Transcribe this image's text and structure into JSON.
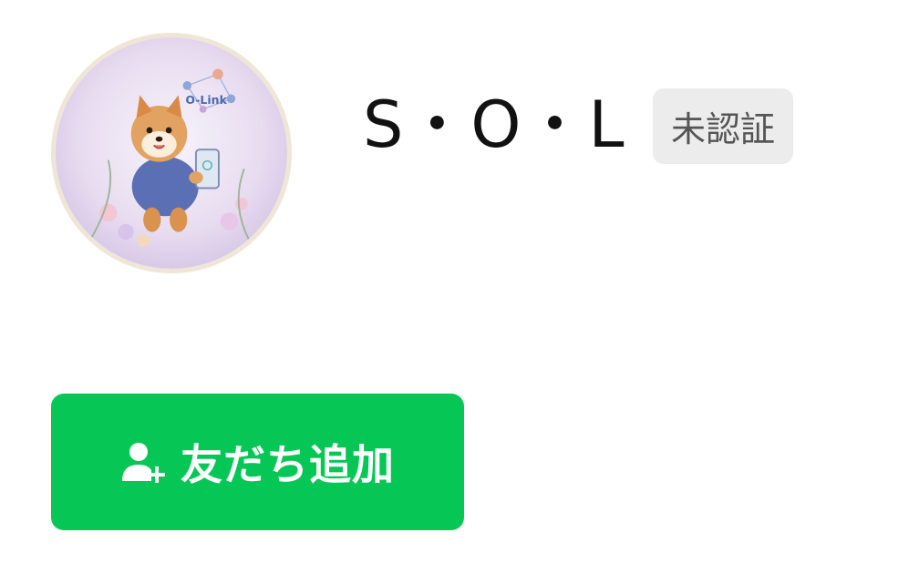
{
  "profile": {
    "avatar_icon": "shiba-dog-avatar-icon",
    "avatar_logo_text": "O-Link",
    "name": "S・O・L",
    "badge": "未認証"
  },
  "actions": {
    "add_friend_label": "友だち追加",
    "add_friend_icon": "add-person-icon"
  },
  "colors": {
    "accent": "#06c755",
    "badge_bg": "#ececec",
    "badge_text": "#555555",
    "name_text": "#111111"
  }
}
